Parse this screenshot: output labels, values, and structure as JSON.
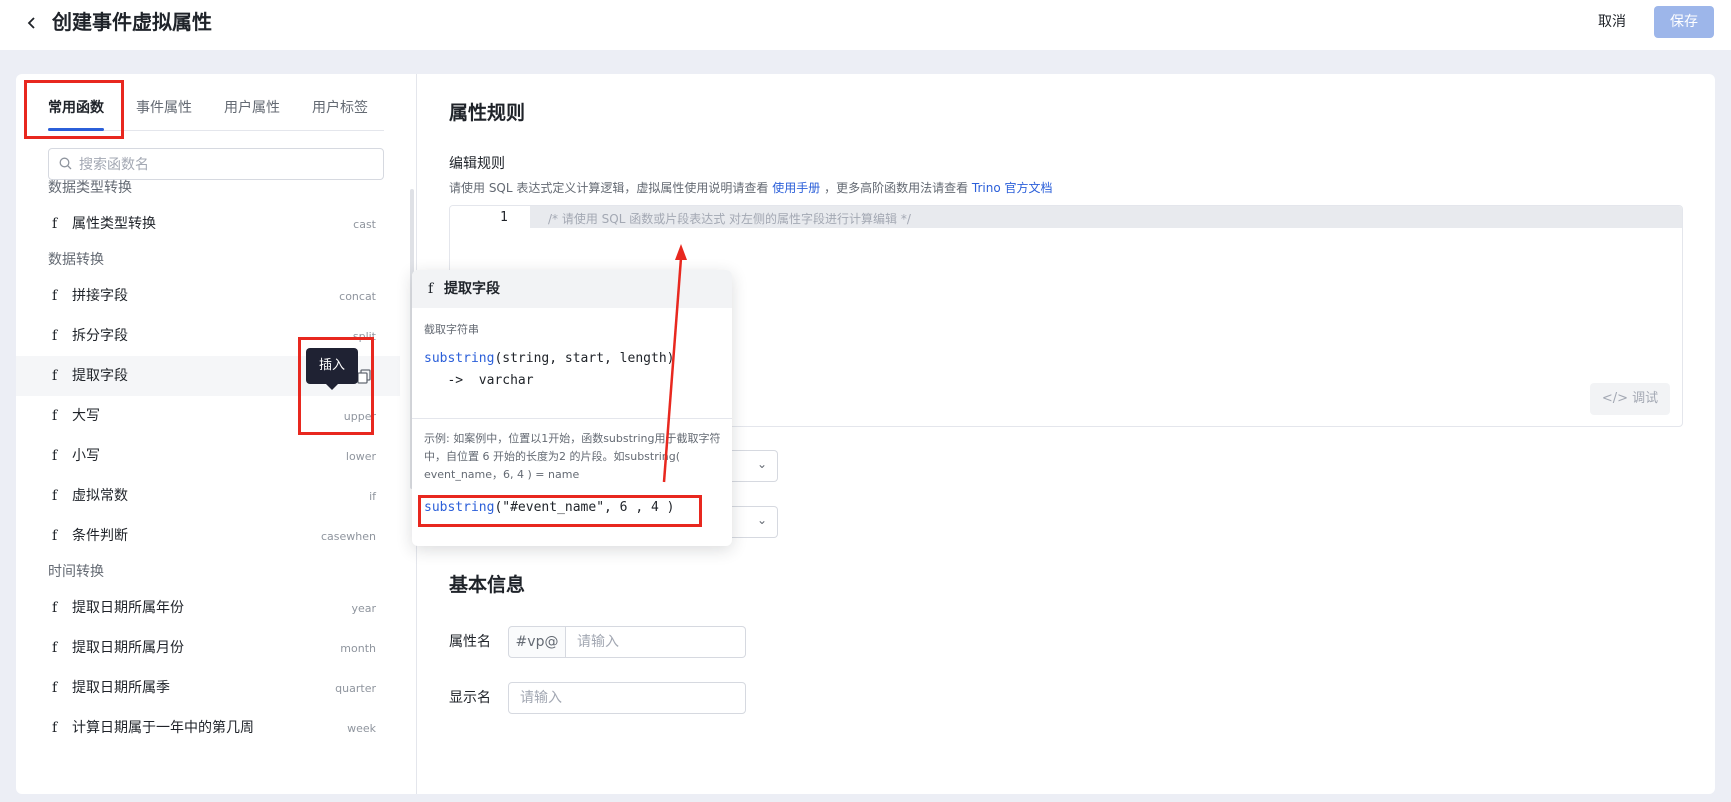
{
  "header": {
    "title": "创建事件虚拟属性",
    "cancel_label": "取消",
    "save_label": "保存"
  },
  "left": {
    "tabs": [
      {
        "label": "常用函数"
      },
      {
        "label": "事件属性"
      },
      {
        "label": "用户属性"
      },
      {
        "label": "用户标签"
      }
    ],
    "search_placeholder": "搜索函数名",
    "groups": [
      {
        "title": "数据类型转换"
      },
      {
        "title": "数据转换"
      },
      {
        "title": "时间转换"
      }
    ],
    "fn_prefix": "f",
    "items": [
      {
        "label": "属性类型转换",
        "code": "cast"
      },
      {
        "label": "拼接字段",
        "code": "concat"
      },
      {
        "label": "拆分字段",
        "code": "split"
      },
      {
        "label": "提取字段",
        "code": ""
      },
      {
        "label": "大写",
        "code": "upper"
      },
      {
        "label": "小写",
        "code": "lower"
      },
      {
        "label": "虚拟常数",
        "code": "if"
      },
      {
        "label": "条件判断",
        "code": "casewhen"
      },
      {
        "label": "提取日期所属年份",
        "code": "year"
      },
      {
        "label": "提取日期所属月份",
        "code": "month"
      },
      {
        "label": "提取日期所属季",
        "code": "quarter"
      },
      {
        "label": "计算日期属于一年中的第几周",
        "code": "week"
      }
    ]
  },
  "tooltip": {
    "label": "插入"
  },
  "popover": {
    "prefix": "f",
    "title": "提取字段",
    "subtitle": "截取字符串",
    "sig_fn": "substring",
    "sig_args": "(string, start, length)",
    "sig_ret": "   ->  varchar",
    "example": "示例: 如案例中，位置以1开始，函数substring用于截取字符中，自位置 6 开始的长度为2 的片段。如substring( event_name，6, 4 ) = name",
    "code_fn": "substring",
    "code_args": "(\"#event_name\", 6 , 4 )"
  },
  "right": {
    "rule_title": "属性规则",
    "edit_label": "编辑规则",
    "desc_prefix": "请使用 SQL 表达式定义计算逻辑，虚拟属性使用说明请查看",
    "manual_link": "使用手册",
    "desc_middle": "，更多高阶函数用法请查看",
    "trino_link": "Trino 官方文档",
    "line_number": "1",
    "editor_placeholder": "/* 请使用 SQL 函数或片段表达式 对左侧的属性字段进行计算编辑 */",
    "debug_label": "</> 调试",
    "basic_title": "基本信息",
    "name_label": "属性名",
    "name_prefix": "#vp@",
    "name_placeholder": "请输入",
    "display_label": "显示名",
    "display_placeholder": "请输入"
  },
  "colors": {
    "accent": "#2b5fd9",
    "highlight": "#e8281f",
    "save_disabled": "#9db6ea"
  }
}
